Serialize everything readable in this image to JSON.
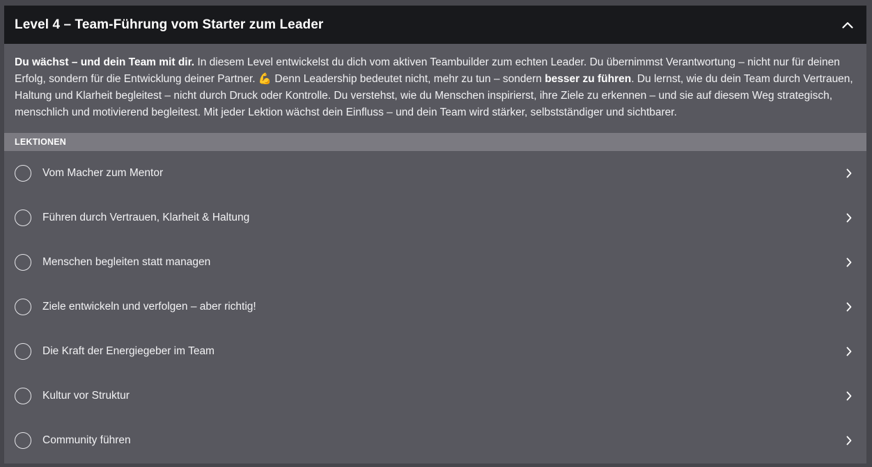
{
  "module": {
    "title": "Level 4 – Team-Führung vom Starter zum Leader",
    "collapse_icon": "chevron-up-icon",
    "description": {
      "lead": "Du wächst – und dein Team mit dir.",
      "part1": " In diesem Level entwickelst du dich vom aktiven Teambuilder zum echten Leader. Du übernimmst Verantwortung – nicht nur für deinen Erfolg, sondern für die Entwicklung deiner Partner. ",
      "emoji": "💪",
      "part2": " Denn Leadership bedeutet nicht, mehr zu tun – sondern ",
      "emphasis": "besser zu führen",
      "part3": ". Du lernst, wie du dein Team durch Vertrauen, Haltung und Klarheit begleitest – nicht durch Druck oder Kontrolle. Du verstehst, wie du Menschen inspirierst, ihre Ziele zu erkennen – und sie auf diesem Weg strategisch, menschlich und motivierend begleitest. Mit jeder Lektion wächst dein Einfluss – und dein Team wird stärker, selbstständiger und sichtbarer."
    },
    "section_label": "LEKTIONEN",
    "lessons": [
      {
        "label": "Vom Macher zum Mentor"
      },
      {
        "label": "Führen durch Vertrauen, Klarheit & Haltung"
      },
      {
        "label": "Menschen begleiten statt managen"
      },
      {
        "label": "Ziele entwickeln und verfolgen – aber richtig!"
      },
      {
        "label": "Die Kraft der Energiegeber im Team"
      },
      {
        "label": "Kultur vor Struktur"
      },
      {
        "label": "Community führen"
      }
    ]
  },
  "colors": {
    "header_bg": "#18191c",
    "panel_bg": "#58585f",
    "section_bg": "#7b7a81",
    "text": "#f2f2f4"
  }
}
